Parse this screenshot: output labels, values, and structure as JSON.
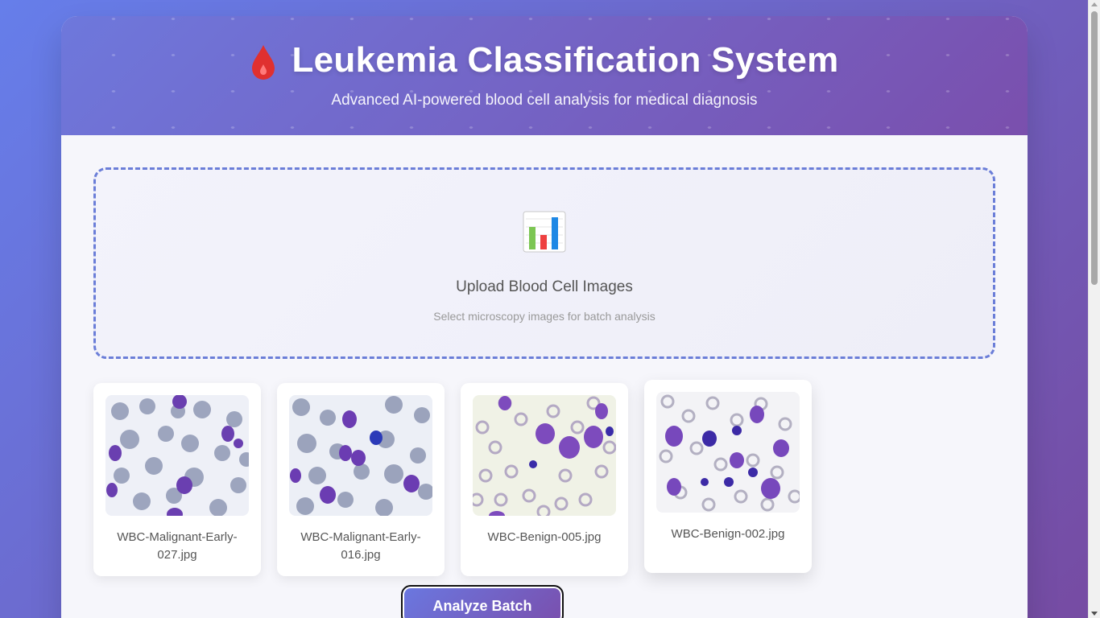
{
  "header": {
    "title": "Leukemia Classification System",
    "subtitle": "Advanced AI-powered blood cell analysis for medical diagnosis",
    "icon": "blood-drop-icon"
  },
  "upload": {
    "icon": "bar-chart-icon",
    "title": "Upload Blood Cell Images",
    "hint": "Select microscopy images for batch analysis"
  },
  "images": [
    {
      "filename": "WBC-Malignant-Early-027.jpg"
    },
    {
      "filename": "WBC-Malignant-Early-016.jpg"
    },
    {
      "filename": "WBC-Benign-005.jpg"
    },
    {
      "filename": "WBC-Benign-002.jpg"
    }
  ],
  "actions": {
    "analyze_label": "Analyze Batch"
  },
  "colors": {
    "accent_start": "#667eea",
    "accent_end": "#764ba2",
    "dashed_border": "#6b7ed8"
  }
}
